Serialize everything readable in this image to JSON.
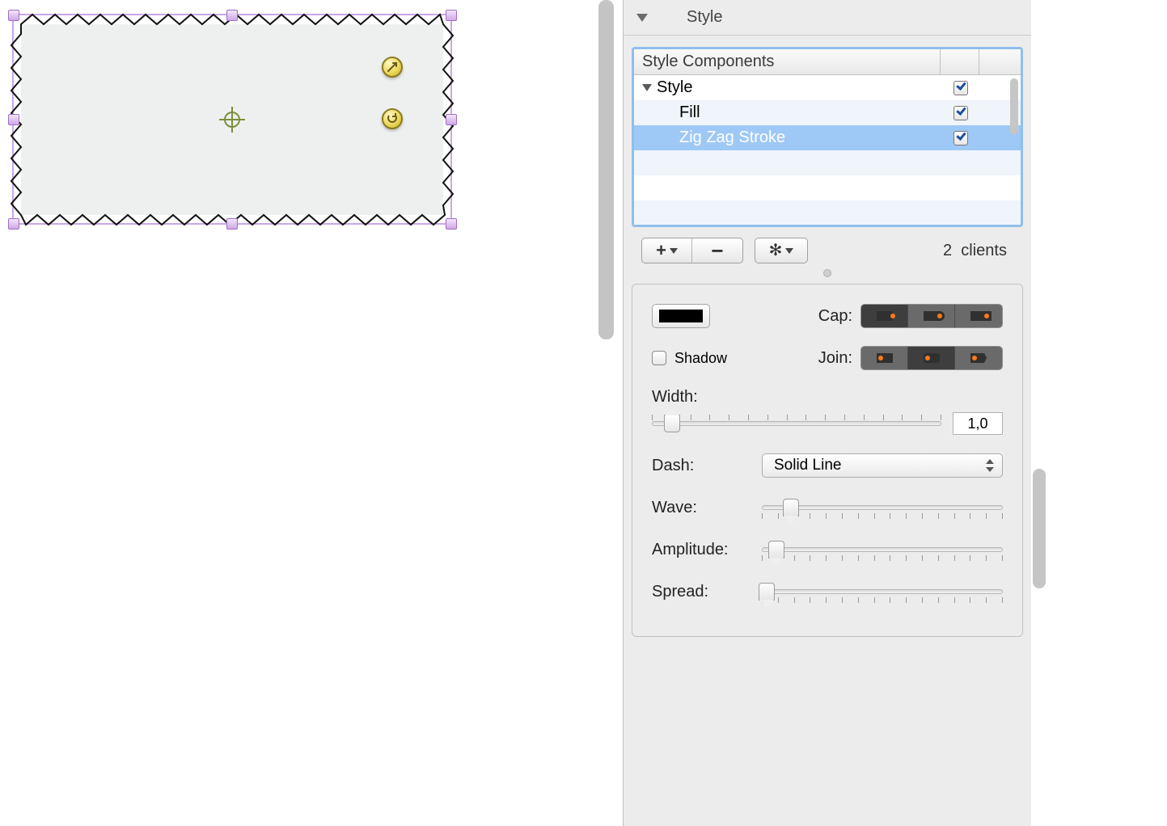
{
  "panel": {
    "title": "Style",
    "components_header": "Style Components",
    "tree": [
      {
        "label": "Style",
        "level": 0,
        "expandable": true,
        "checked": true,
        "selected": false
      },
      {
        "label": "Fill",
        "level": 1,
        "expandable": false,
        "checked": true,
        "selected": false
      },
      {
        "label": "Zig Zag Stroke",
        "level": 1,
        "expandable": false,
        "checked": true,
        "selected": true
      }
    ],
    "clients_count": "2",
    "clients_label": "clients",
    "stroke": {
      "cap_label": "Cap:",
      "shadow_label": "Shadow",
      "shadow_checked": false,
      "join_label": "Join:",
      "width_label": "Width:",
      "width_value": "1,0",
      "dash_label": "Dash:",
      "dash_value": "Solid Line",
      "wave_label": "Wave:",
      "amplitude_label": "Amplitude:",
      "spread_label": "Spread:",
      "cap_selected": 0,
      "join_selected": 1,
      "width_slider": 3,
      "wave_slider": 8,
      "amplitude_slider": 3,
      "spread_slider": 0
    }
  }
}
